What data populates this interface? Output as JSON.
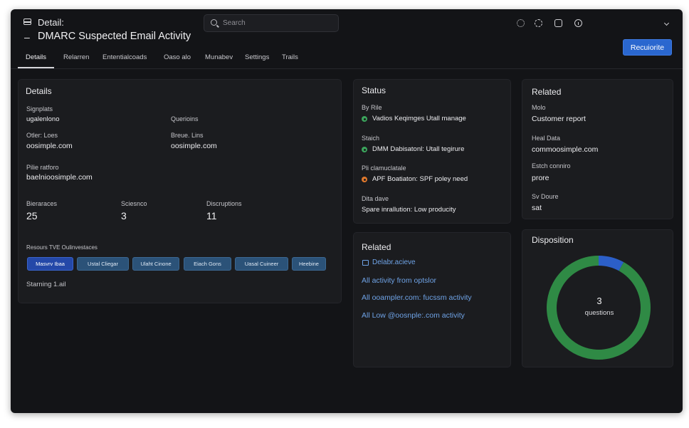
{
  "header": {
    "breadcrumb": "Detail:",
    "title_prefix": "–",
    "title": "DMARC Suspected Email Activity",
    "primary_button": "Recuiorite"
  },
  "search": {
    "placeholder": "Search",
    "value": ""
  },
  "header_icons": [
    "spinner-icon",
    "loader-icon",
    "message-icon",
    "info-icon",
    "chevron-down-icon"
  ],
  "tabs": [
    {
      "label": "Details",
      "active": true
    },
    {
      "label": "Relarren",
      "active": false
    },
    {
      "label": "Ententialcoads",
      "active": false
    },
    {
      "label": "Oaso alo",
      "active": false
    },
    {
      "label": "Munabev",
      "active": false
    },
    {
      "label": "Settings",
      "active": false
    },
    {
      "label": "Trails",
      "active": false
    }
  ],
  "details": {
    "title": "Details",
    "fields": [
      {
        "label": "Signplats",
        "value": "ugalenlono"
      },
      {
        "label": "Querioins",
        "value": ""
      },
      {
        "label": "Otler: Loes",
        "value": "oosimple.com"
      },
      {
        "label": "Breue. Lins",
        "value": "oosimple.com"
      },
      {
        "label": "Pilie ratforo",
        "value": "baelnioosimple.com"
      }
    ],
    "metrics": [
      {
        "label": "Bieraraces",
        "value": "25"
      },
      {
        "label": "Sciesnco",
        "value": "3"
      },
      {
        "label": "Discruptions",
        "value": "11"
      }
    ],
    "resources_label": "Resours TVE Oulinvestaces",
    "chips": [
      "Masvrv Ibaa",
      "Ustal Cliegar",
      "Ulaht Cinone",
      "Eiach Gons",
      "Uasal Cuineer",
      "Heebine"
    ],
    "footer": "Starning 1.ail"
  },
  "status": {
    "title": "Status",
    "items": [
      {
        "label": "By Rile",
        "value": "Vadios Keqimges Utall manage",
        "color": "#3ba55c"
      },
      {
        "label": "Staich",
        "value": "DMM Dabisatonl: Utall tegirure",
        "color": "#3ba55c"
      },
      {
        "label": "Pli clamuclatale",
        "value": "APF Boatiaton: SPF poley need",
        "color": "#e0782c"
      },
      {
        "label": "Dita dave",
        "value": "Spare inrallution: Low producity",
        "color": ""
      }
    ]
  },
  "related_top": {
    "title": "Related",
    "fields": [
      {
        "label": "Molo",
        "value": "Customer report"
      },
      {
        "label": "Heal Data",
        "value": "commoosimple.com"
      },
      {
        "label": "Estch conniro",
        "value": "prore"
      },
      {
        "label": "Sv Doure",
        "value": "sat"
      }
    ]
  },
  "related_links": {
    "title": "Related",
    "links": [
      "Delabr.acieve",
      "All activity from optslor",
      "All ooampler.com: fucssm activity",
      "All Low @oosnple:.com activity"
    ]
  },
  "disposition": {
    "title": "Disposition",
    "count": "3",
    "unit": "questions",
    "segments": [
      {
        "fraction": 0.92,
        "color": "#2f8a45"
      },
      {
        "fraction": 0.08,
        "color": "#2c5fc8"
      }
    ]
  }
}
